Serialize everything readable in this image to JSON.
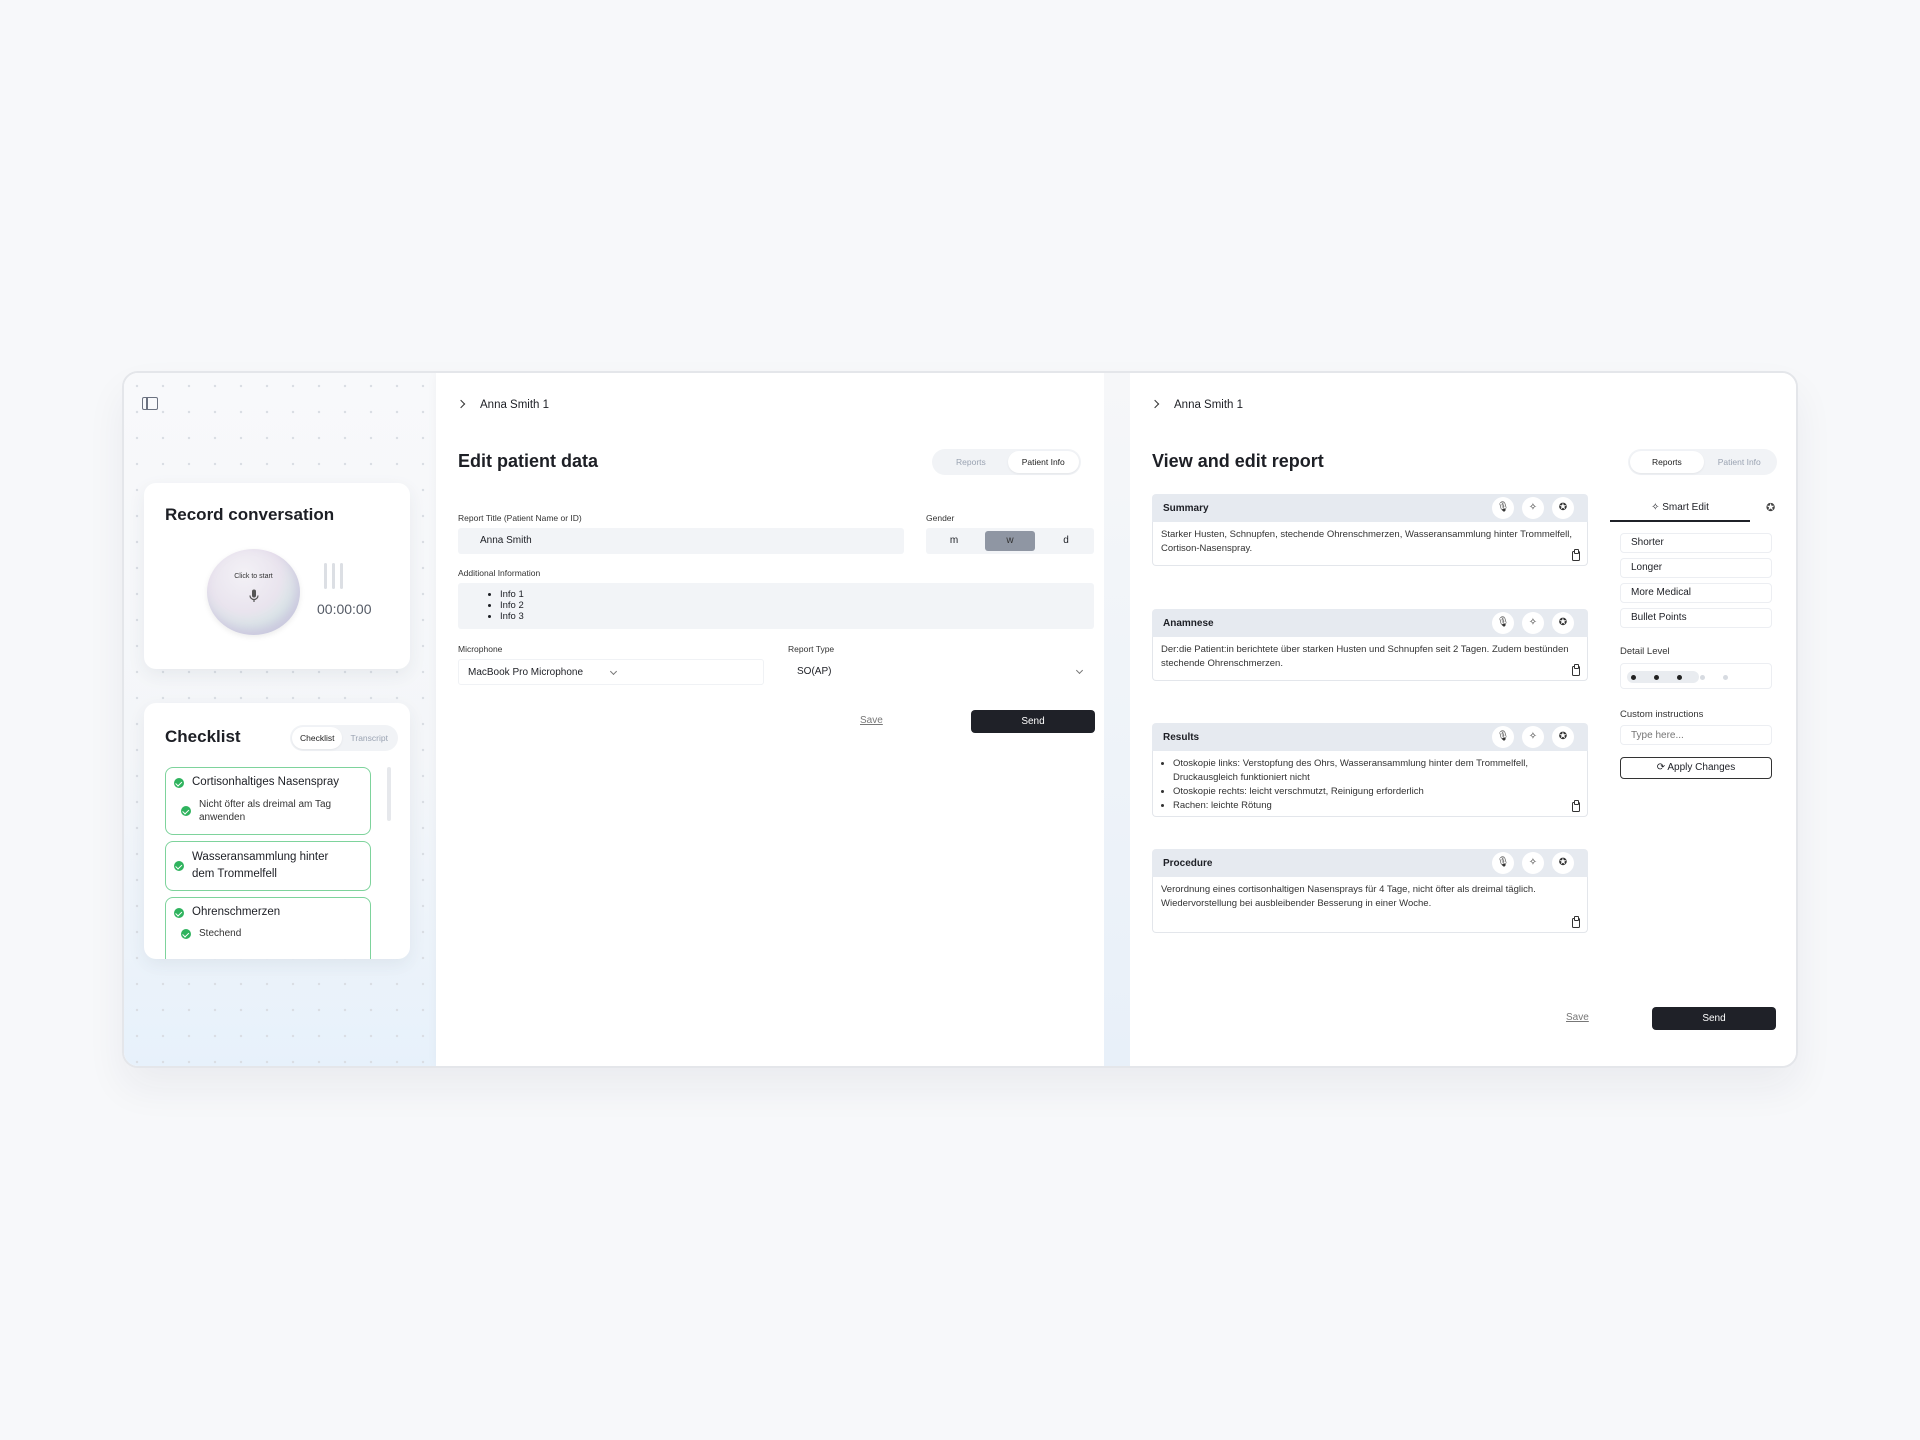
{
  "sidebar": {
    "record": {
      "title": "Record conversation",
      "button_label": "Click to start",
      "timer": "00:00:00"
    },
    "checklist": {
      "title": "Checklist",
      "tabs": [
        "Checklist",
        "Transcript"
      ],
      "active_tab": "Checklist",
      "items": [
        {
          "label": "Cortisonhaltiges Nasenspray",
          "sub": "Nicht öfter als dreimal am Tag anwenden"
        },
        {
          "label": "Wasseransammlung hinter dem Trommelfell",
          "sub": ""
        },
        {
          "label": "Ohrenschmerzen",
          "sub": "Stechend"
        }
      ]
    }
  },
  "patient_panel": {
    "breadcrumb": "Anna Smith 1",
    "title": "Edit patient data",
    "tabs": [
      "Reports",
      "Patient Info"
    ],
    "active_tab": "Patient Info",
    "report_title_label": "Report Title (Patient Name or ID)",
    "report_title_value": "Anna Smith",
    "gender_label": "Gender",
    "gender_options": [
      "m",
      "w",
      "d"
    ],
    "gender_selected": "w",
    "additional_label": "Additional Information",
    "additional_items": [
      "Info 1",
      "Info 2",
      "Info 3"
    ],
    "microphone_label": "Microphone",
    "microphone_value": "MacBook Pro Microphone",
    "report_type_label": "Report Type",
    "report_type_value": "SO(AP)",
    "save_label": "Save",
    "send_label": "Send"
  },
  "report_panel": {
    "breadcrumb": "Anna Smith 1",
    "title": "View and edit report",
    "tabs": [
      "Reports",
      "Patient Info"
    ],
    "active_tab": "Reports",
    "sections": [
      {
        "title": "Summary",
        "text": "Starker Husten, Schnupfen, stechende Ohrenschmerzen, Wasseransammlung hinter Trommelfell, Cortison-Nasenspray."
      },
      {
        "title": "Anamnese",
        "text": "Der:die Patient:in berichtete über starken Husten und Schnupfen seit 2 Tagen. Zudem bestünden stechende Ohrenschmerzen."
      },
      {
        "title": "Results",
        "bullets": [
          "Otoskopie links: Verstopfung des Ohrs, Wasseransammlung hinter dem Trommelfell, Druckausgleich funktioniert nicht",
          "Otoskopie rechts: leicht verschmutzt, Reinigung erforderlich",
          "Rachen: leichte Rötung"
        ]
      },
      {
        "title": "Procedure",
        "text": "Verordnung eines cortisonhaltigen Nasensprays für 4 Tage, nicht öfter als dreimal täglich. Wiedervorstellung bei ausbleibender Besserung in einer Woche."
      }
    ],
    "smart_edit": {
      "tab_label": "Smart Edit",
      "options": [
        "Shorter",
        "Longer",
        "More Medical",
        "Bullet Points"
      ],
      "detail_label": "Detail Level",
      "detail_level": 3,
      "detail_max": 5,
      "custom_label": "Custom instructions",
      "custom_placeholder": "Type here...",
      "apply_label": "Apply Changes"
    },
    "save_label": "Save",
    "send_label": "Send"
  }
}
